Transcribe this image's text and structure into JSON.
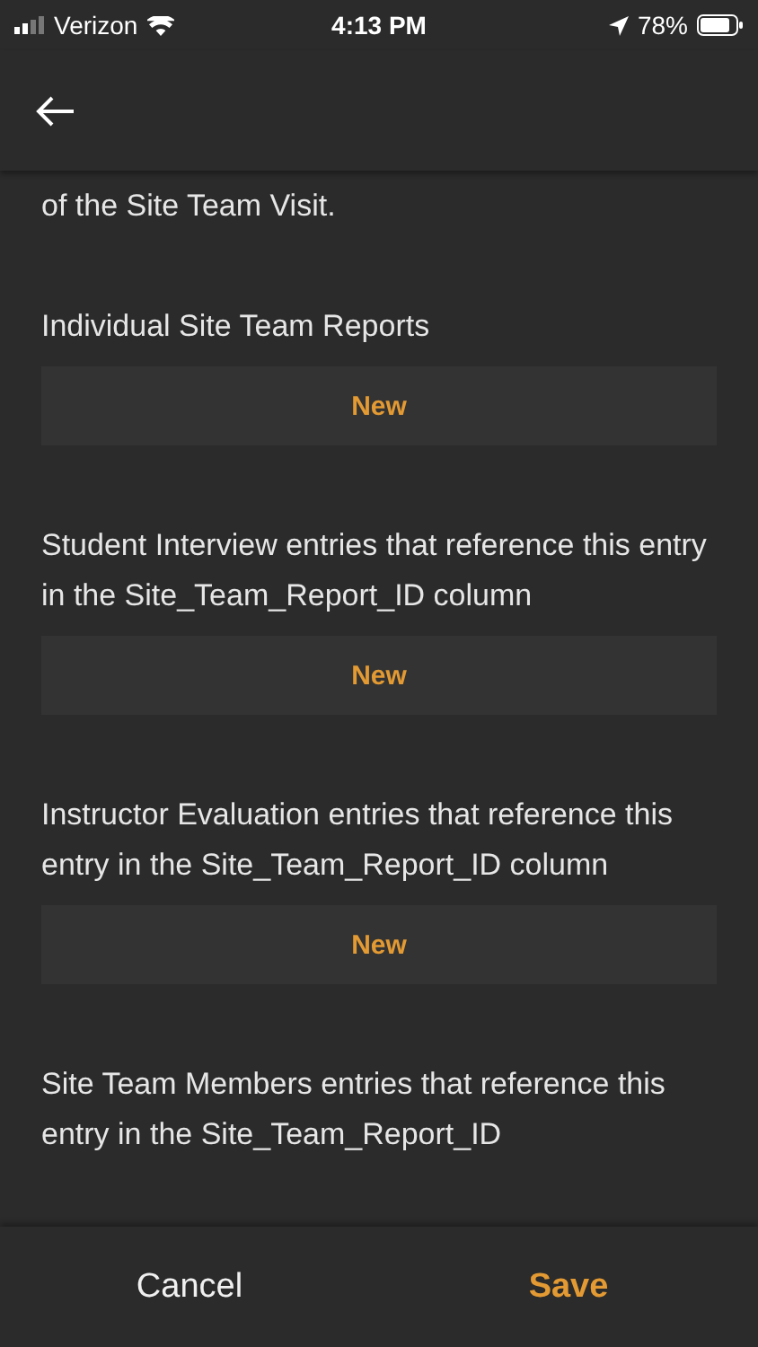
{
  "status_bar": {
    "carrier": "Verizon",
    "time": "4:13 PM",
    "battery": "78%"
  },
  "intro_text": "of the Site Team Visit.",
  "sections": [
    {
      "label": "Individual Site Team Reports",
      "button": "New"
    },
    {
      "label": "Student Interview entries that reference this entry in the Site_Team_Report_ID column",
      "button": "New"
    },
    {
      "label": "Instructor Evaluation entries that reference this entry in the Site_Team_Report_ID column",
      "button": "New"
    },
    {
      "label": "Site Team Members entries that reference this entry in the Site_Team_Report_ID"
    }
  ],
  "footer": {
    "cancel": "Cancel",
    "save": "Save"
  }
}
